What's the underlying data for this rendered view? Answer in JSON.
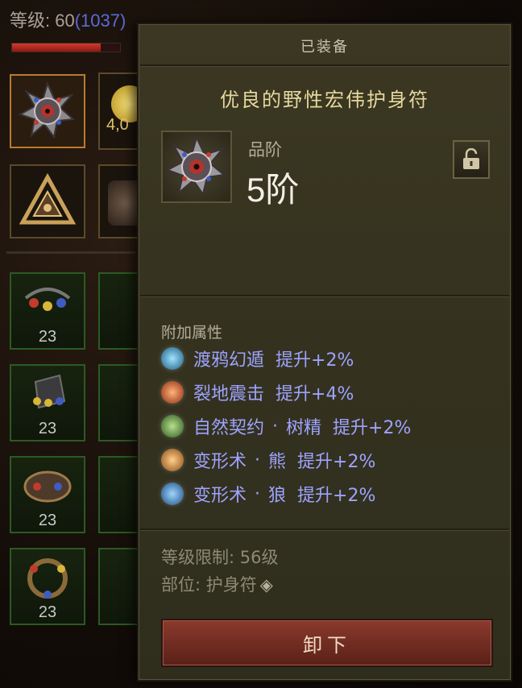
{
  "background": {
    "level_prefix": "等级: 60",
    "level_paren": "(1037)",
    "hp_fill_fraction": 0.82,
    "slot_peek_number": "4,0",
    "green_slot_counts": [
      "23",
      "23",
      "23",
      "23"
    ]
  },
  "tooltip": {
    "header": "已装备",
    "item_name": "优良的野性宏伟护身符",
    "grade_label": "品阶",
    "grade_value": "5阶",
    "lock_icon": "lock-open-icon",
    "attributes_title": "附加属性",
    "affixes": [
      {
        "skill": "渡鸦幻遁",
        "effect": "提升+2%",
        "icon": "raven-skill-icon",
        "color": "#3a8bb0"
      },
      {
        "skill": "裂地震击",
        "effect": "提升+4%",
        "icon": "earth-skill-icon",
        "color": "#c2562a"
      },
      {
        "skill": "自然契约",
        "dot": "·",
        "sub": "树精",
        "effect": "提升+2%",
        "icon": "nature-skill-icon",
        "color": "#4f7a3a"
      },
      {
        "skill": "变形术",
        "dot": "·",
        "sub": "熊",
        "effect": "提升+2%",
        "icon": "bear-skill-icon",
        "color": "#c0732c"
      },
      {
        "skill": "变形术",
        "dot": "·",
        "sub": "狼",
        "effect": "提升+2%",
        "icon": "wolf-skill-icon",
        "color": "#3e86b8"
      }
    ],
    "level_req": "等级限制: 56级",
    "slot_label": "部位: 护身符",
    "unequip_label": "卸下"
  }
}
